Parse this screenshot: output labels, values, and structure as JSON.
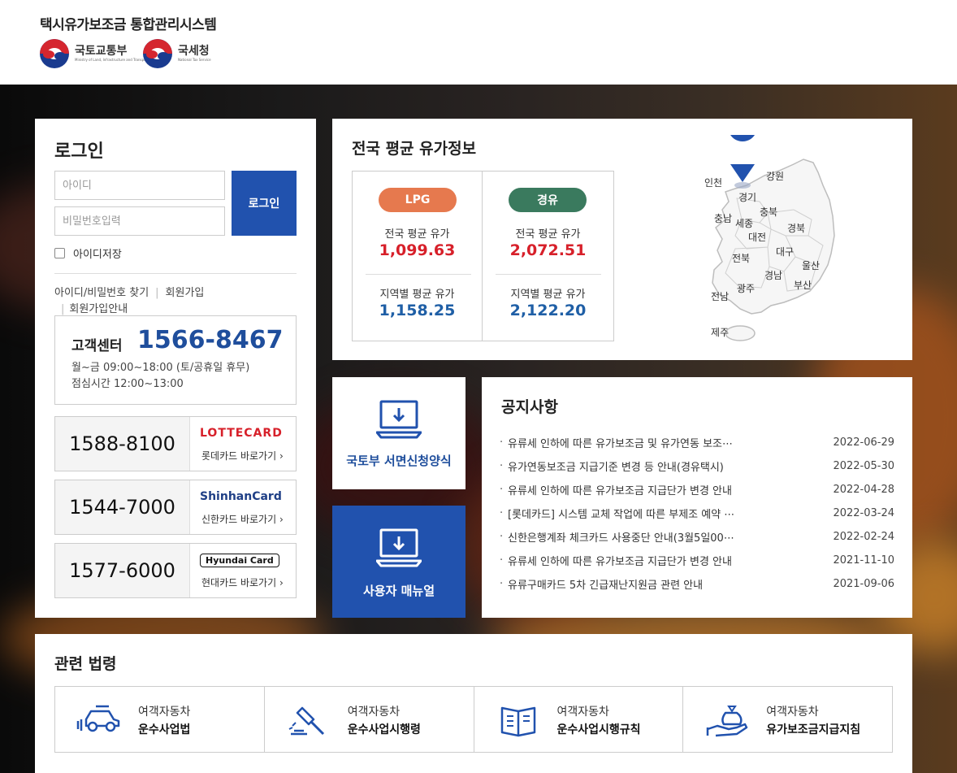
{
  "header": {
    "site_title": "택시유가보조금 통합관리시스템",
    "logo1": {
      "name": "국토교통부",
      "sub": "Ministry of Land, Infrastructure and Transport"
    },
    "logo2": {
      "name": "국세청",
      "sub": "National Tax Service"
    }
  },
  "login": {
    "title": "로그인",
    "id_placeholder": "아이디",
    "pw_placeholder": "비밀번호입력",
    "button": "로그인",
    "save_id": "아이디저장",
    "links": [
      "아이디/비밀번호 찾기",
      "회원가입",
      "회원가입안내"
    ]
  },
  "customer_center": {
    "label": "고객센터",
    "phone": "1566-8467",
    "hours": "월~금 09:00~18:00 (토/공휴일 휴무)",
    "lunch": "점심시간 12:00~13:00"
  },
  "cards": [
    {
      "phone": "1588-8100",
      "brand": "LOTTECARD",
      "link": "롯데카드 바로가기 ›"
    },
    {
      "phone": "1544-7000",
      "brand": "ShinhanCard",
      "link": "신한카드 바로가기 ›"
    },
    {
      "phone": "1577-6000",
      "brand": "Hyundai Card",
      "link": "현대카드 바로가기 ›"
    }
  ],
  "fuel": {
    "title": "전국 평균 유가정보",
    "lpg": {
      "label": "LPG",
      "national_label": "전국 평균 유가",
      "national": "1,099.63",
      "regional_label": "지역별 평균 유가",
      "regional": "1,158.25"
    },
    "diesel": {
      "label": "경유",
      "national_label": "전국 평균 유가",
      "national": "2,072.51",
      "regional_label": "지역별 평균 유가",
      "regional": "2,122.20"
    },
    "selected_region": "서울",
    "regions": [
      "인천",
      "강원",
      "경기",
      "충북",
      "충남",
      "세종",
      "대전",
      "경북",
      "대구",
      "전북",
      "경남",
      "울산",
      "광주",
      "부산",
      "전남",
      "제주"
    ]
  },
  "quick_links": [
    {
      "label": "국토부 서면신청양식"
    },
    {
      "label": "사용자 매뉴얼"
    }
  ],
  "notices": {
    "title": "공지사항",
    "items": [
      {
        "title": "유류세 인하에 따른 유가보조금 및 유가연동 보조⋯",
        "date": "2022-06-29"
      },
      {
        "title": "유가연동보조금 지급기준 변경 등 안내(경유택시)",
        "date": "2022-05-30"
      },
      {
        "title": "유류세 인하에 따른 유가보조금 지급단가 변경 안내",
        "date": "2022-04-28"
      },
      {
        "title": "[롯데카드] 시스템 교체 작업에 따른 부제조 예약 ⋯",
        "date": "2022-03-24"
      },
      {
        "title": "신한은행계좌 체크카드 사용중단 안내(3월5일00⋯",
        "date": "2022-02-24"
      },
      {
        "title": "유류세 인하에 따른 유가보조금 지급단가 변경 안내",
        "date": "2021-11-10"
      },
      {
        "title": "유류구매카드 5차 긴급재난지원금 관련 안내",
        "date": "2021-09-06"
      }
    ]
  },
  "laws": {
    "title": "관련 법령",
    "items": [
      {
        "line1": "여객자동차",
        "line2": "운수사업법",
        "icon": "car-icon"
      },
      {
        "line1": "여객자동차",
        "line2": "운수사업시행령",
        "icon": "gavel-icon"
      },
      {
        "line1": "여객자동차",
        "line2": "운수사업시행규칙",
        "icon": "book-icon"
      },
      {
        "line1": "여객자동차",
        "line2": "유가보조금지급지침",
        "icon": "money-hand-icon"
      }
    ]
  },
  "colors": {
    "primary": "#2152ae",
    "lpg": "#e6794e",
    "diesel": "#3a7a5e",
    "price_red": "#d7202a",
    "price_blue": "#1f5fa6"
  }
}
